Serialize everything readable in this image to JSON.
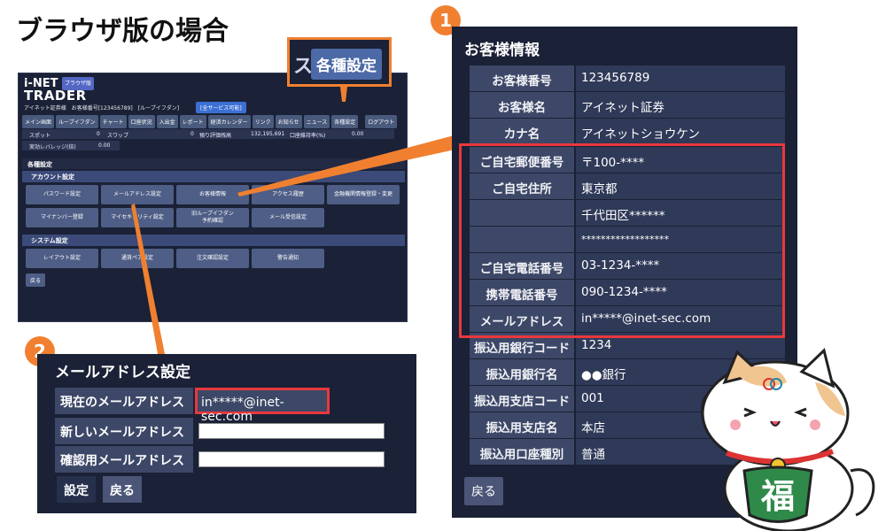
{
  "page_title": "ブラウザ版の場合",
  "app": {
    "logo_top": "i-NET",
    "logo_badge": "ブラウザ版",
    "logo_bottom": "TRADER",
    "info_line": "アイネット証券様　お客様番号[123456789]　[ループイフダン]",
    "service_badge": "[全サービス可能]",
    "menu": [
      "メイン画面",
      "ループイフダン",
      "チャート",
      "口座状況",
      "入出金",
      "レポート",
      "経済カレンダー",
      "リンク",
      "お知らせ",
      "ニュース",
      "各種設定",
      "ログアウト"
    ],
    "stats1": {
      "spot_label": "スポット",
      "spot_value": "0",
      "swap_label": "スワップ",
      "swap_value": "0",
      "valuation_label": "預り評価残高",
      "valuation_value": "132,195,691",
      "maintenance_label": "口座維持率(%)",
      "maintenance_value": "0.00"
    },
    "stats2": {
      "leverage_label": "実効レバレッジ(倍)",
      "leverage_value": "0.00"
    },
    "section_settings": "各種設定",
    "section_account": "アカウント設定",
    "account_buttons": [
      "パスワード設定",
      "メールアドレス設定",
      "お客様情報",
      "アクセス履歴",
      "金融機関情報登録・変更",
      "マイナンバー登録",
      "マイセキュリティ設定",
      "旧ループイフダン\n予約確認",
      "メール受信設定"
    ],
    "section_system": "システム設定",
    "system_buttons": [
      "レイアウト設定",
      "通貨ペア設定",
      "注文確認設定",
      "警告通知"
    ],
    "back_label": "戻る"
  },
  "zoom": {
    "fragment": "ス",
    "button": "各種設定"
  },
  "markers": {
    "one": "1",
    "two": "2"
  },
  "email_panel": {
    "title": "メールアドレス設定",
    "current_label": "現在のメールアドレス",
    "current_value": "in*****@inet-sec.com",
    "new_label": "新しいメールアドレス",
    "confirm_label": "確認用メールアドレス",
    "set_button": "設定",
    "back_button": "戻る"
  },
  "customer_panel": {
    "title": "お客様情報",
    "rows": [
      {
        "label": "お客様番号",
        "value": "123456789"
      },
      {
        "label": "お客様名",
        "value": "アイネット証券"
      },
      {
        "label": "カナ名",
        "value": "アイネットショウケン"
      },
      {
        "label": "ご自宅郵便番号",
        "value": "〒100-****"
      },
      {
        "label": "ご自宅住所",
        "value": "東京都"
      },
      {
        "label": "",
        "value": "千代田区******"
      },
      {
        "label": "",
        "value": "******************"
      },
      {
        "label": "ご自宅電話番号",
        "value": "03-1234-****"
      },
      {
        "label": "携帯電話番号",
        "value": "090-1234-****"
      },
      {
        "label": "メールアドレス",
        "value": "in*****@inet-sec.com"
      },
      {
        "label": "振込用銀行コード",
        "value": "1234"
      },
      {
        "label": "振込用銀行名",
        "value": "●●銀行"
      },
      {
        "label": "振込用支店コード",
        "value": "001"
      },
      {
        "label": "振込用支店名",
        "value": "本店"
      },
      {
        "label": "振込用口座種別",
        "value": "普通"
      }
    ],
    "back_button": "戻る"
  },
  "mascot": {
    "bib_text": "福"
  },
  "colors": {
    "panel_bg": "#1b2136",
    "label_bg": "#3d4868",
    "accent_orange": "#f08030",
    "highlight_red": "#e8383d"
  }
}
